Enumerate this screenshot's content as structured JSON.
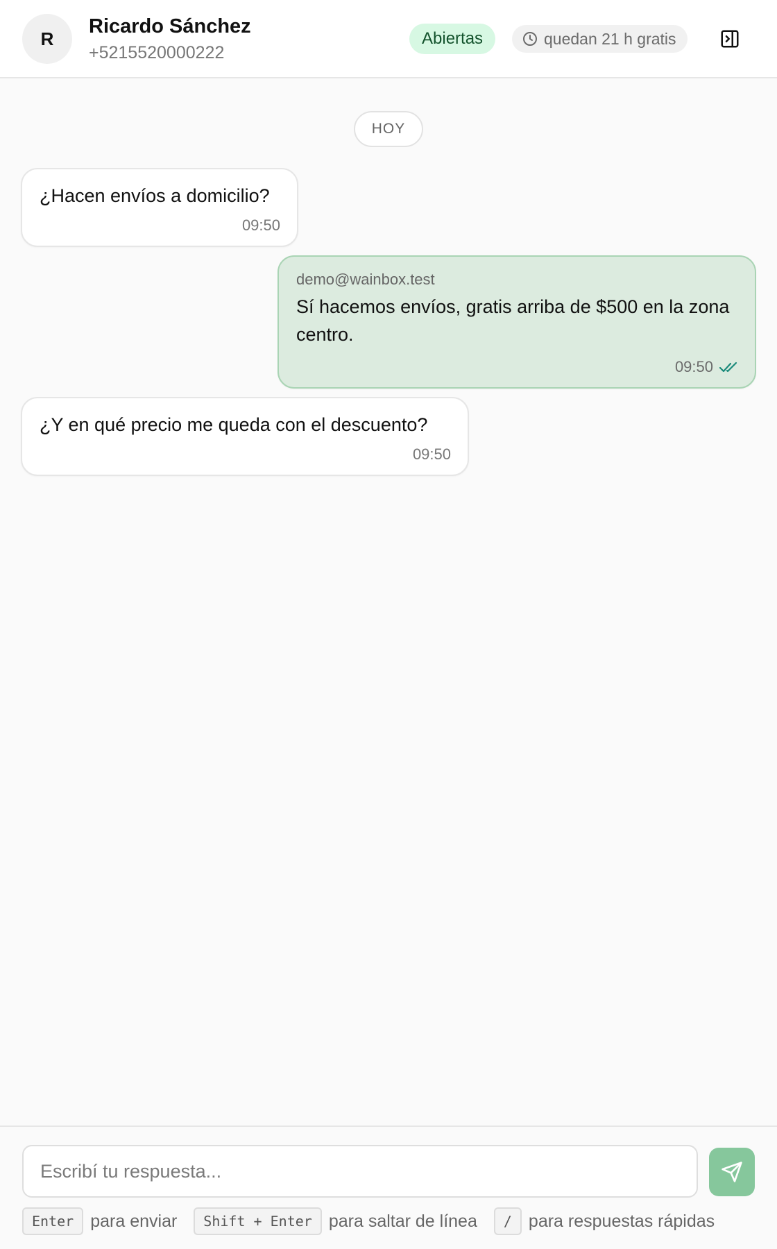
{
  "header": {
    "avatar_initial": "R",
    "contact_name": "Ricardo Sánchez",
    "contact_phone": "+5215520000222",
    "status_label": "Abiertas",
    "window_label": "quedan 21 h gratis",
    "icons": {
      "window": "clock-icon",
      "panel": "panel-toggle-icon"
    }
  },
  "conversation": {
    "day_separator": "HOY",
    "messages": [
      {
        "direction": "incoming",
        "text": "¿Hacen envíos a domicilio?",
        "time": "09:50"
      },
      {
        "direction": "outgoing",
        "sender": "demo@wainbox.test",
        "text": "Sí hacemos envíos, gratis arriba de $500 en la zona centro.",
        "time": "09:50",
        "status": "read",
        "status_icon": "double-check-icon"
      },
      {
        "direction": "incoming",
        "text": "¿Y en qué precio me queda con el descuento?",
        "time": "09:50"
      }
    ]
  },
  "composer": {
    "placeholder": "Escribí tu respuesta...",
    "value": "",
    "send_icon": "send-icon",
    "hints": [
      {
        "key": "Enter",
        "text": "para enviar"
      },
      {
        "key": "Shift + Enter",
        "text": "para saltar de línea"
      },
      {
        "key": "/",
        "text": "para respuestas rápidas"
      }
    ]
  },
  "colors": {
    "accent": "#86c79c",
    "status_badge_bg": "#d7f8e3",
    "outgoing_bubble_bg": "#dcebdf",
    "read_check": "#1a8a7a"
  }
}
